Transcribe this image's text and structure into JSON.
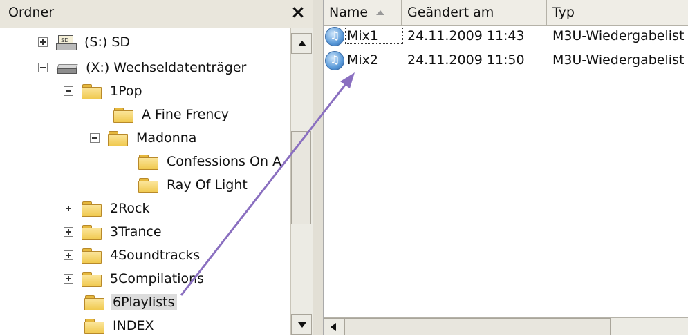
{
  "folder_pane": {
    "title": "Ordner",
    "close_glyph": "×",
    "tree": [
      {
        "label": "(S:) SD",
        "icon": "sd-card-icon",
        "expander": "plus"
      },
      {
        "label": "(X:) Wechseldatenträger",
        "icon": "removable-drive-icon",
        "expander": "minus"
      },
      {
        "label": "1Pop",
        "icon": "folder-icon",
        "expander": "minus"
      },
      {
        "label": "A Fine Frency",
        "icon": "folder-icon",
        "expander": "none"
      },
      {
        "label": "Madonna",
        "icon": "folder-icon",
        "expander": "minus"
      },
      {
        "label": "Confessions On A",
        "icon": "folder-icon",
        "expander": "none"
      },
      {
        "label": "Ray Of Light",
        "icon": "folder-icon",
        "expander": "none"
      },
      {
        "label": "2Rock",
        "icon": "folder-icon",
        "expander": "plus"
      },
      {
        "label": "3Trance",
        "icon": "folder-icon",
        "expander": "plus"
      },
      {
        "label": "4Soundtracks",
        "icon": "folder-icon",
        "expander": "plus"
      },
      {
        "label": "5Compilations",
        "icon": "folder-icon",
        "expander": "plus"
      },
      {
        "label": "6Playlists",
        "icon": "folder-icon",
        "expander": "none",
        "selected": true
      },
      {
        "label": "INDEX",
        "icon": "folder-icon",
        "expander": "none"
      }
    ]
  },
  "file_list": {
    "columns": [
      "Name",
      "Geändert am",
      "Typ"
    ],
    "rows": [
      {
        "name": "Mix1",
        "modified": "24.11.2009 11:43",
        "type": "M3U-Wiedergabelist",
        "icon": "playlist-icon"
      },
      {
        "name": "Mix2",
        "modified": "24.11.2009 11:50",
        "type": "M3U-Wiedergabelist",
        "icon": "playlist-icon"
      }
    ]
  },
  "annotation": {
    "arrow_color": "#8a6fc0"
  },
  "colors": {
    "toolbar_bg": "#e9e6dc",
    "selection_bg": "#dcdcdc",
    "folder_yellow": "#f0c94f"
  }
}
